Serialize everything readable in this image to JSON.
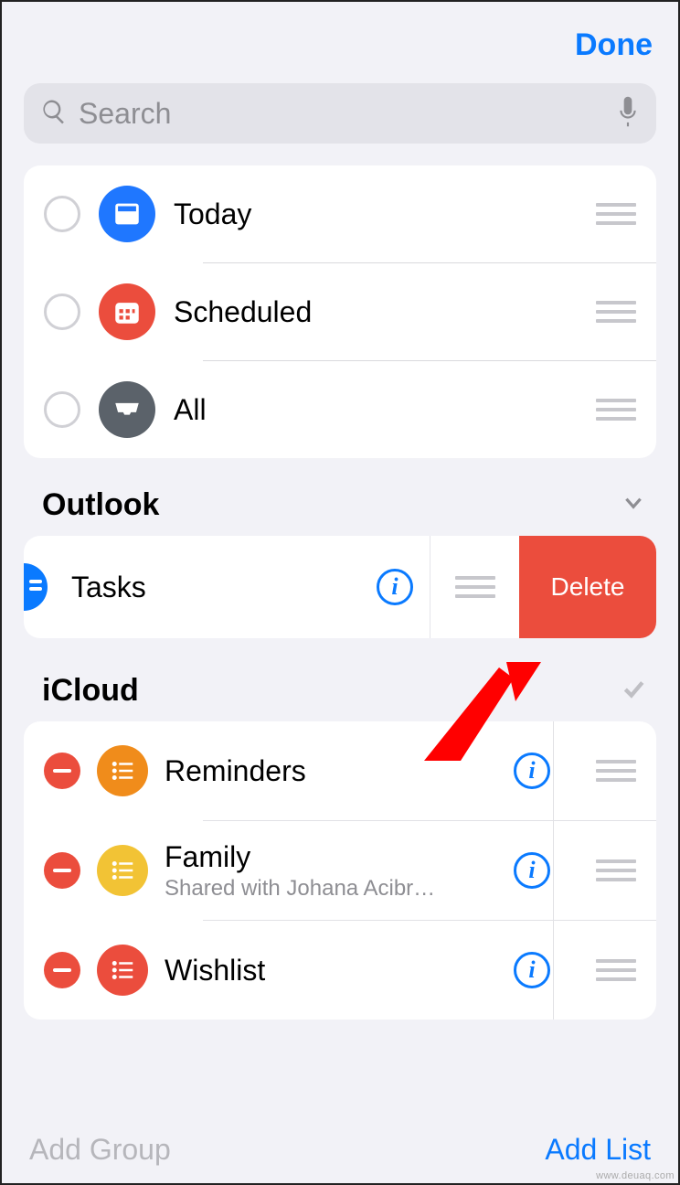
{
  "header": {
    "done": "Done"
  },
  "search": {
    "placeholder": "Search"
  },
  "smart_lists": [
    {
      "label": "Today",
      "icon": "today",
      "color": "#1f77ff"
    },
    {
      "label": "Scheduled",
      "icon": "calendar",
      "color": "#eb4d3d"
    },
    {
      "label": "All",
      "icon": "inbox",
      "color": "#5b626a"
    }
  ],
  "sections": {
    "outlook": {
      "title": "Outlook"
    },
    "icloud": {
      "title": "iCloud"
    }
  },
  "swiped_row": {
    "label": "Tasks",
    "delete": "Delete"
  },
  "icloud_lists": [
    {
      "label": "Reminders",
      "subtitle": "",
      "color": "#f08c1b"
    },
    {
      "label": "Family",
      "subtitle": "Shared with Johana Acibr…",
      "color": "#f2c335"
    },
    {
      "label": "Wishlist",
      "subtitle": "",
      "color": "#eb4d3d"
    }
  ],
  "footer": {
    "add_group": "Add Group",
    "add_list": "Add List"
  },
  "watermark": "www.deuaq.com"
}
